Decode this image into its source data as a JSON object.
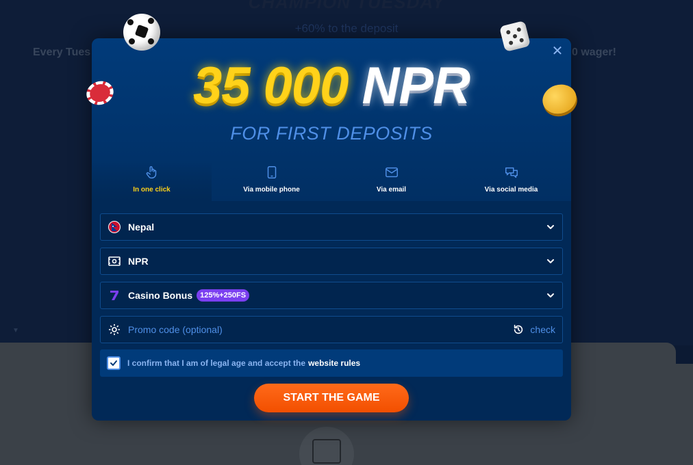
{
  "background": {
    "heading": "CHAMPION TUESDAY",
    "subheading": "+60% to the deposit",
    "left_text": "Every Tues",
    "right_text": "0 wager!"
  },
  "modal": {
    "close_label": "✕",
    "amount_number": "35 000",
    "amount_currency": "NPR",
    "subtitle": "FOR FIRST DEPOSITS",
    "tabs": [
      {
        "label": "In one click",
        "icon": "pointer-hand-icon",
        "active": true
      },
      {
        "label": "Via mobile phone",
        "icon": "mobile-phone-icon",
        "active": false
      },
      {
        "label": "Via email",
        "icon": "envelope-icon",
        "active": false
      },
      {
        "label": "Via social media",
        "icon": "chat-bubbles-icon",
        "active": false
      }
    ],
    "country": {
      "value": "Nepal",
      "icon": "nepal-flag-icon"
    },
    "currency": {
      "value": "NPR",
      "icon": "banknote-icon"
    },
    "bonus": {
      "value": "Casino Bonus",
      "badge": "125%+250FS",
      "icon": "casino-seven-icon"
    },
    "promo": {
      "placeholder": "Promo code (optional)",
      "value": "",
      "check_label": "check"
    },
    "confirm": {
      "text": "I confirm that I am of legal age and accept the",
      "link": "website rules",
      "checked": true
    },
    "start_button": "START THE GAME"
  },
  "colors": {
    "accent_yellow": "#ffd21a",
    "accent_blue": "#4f8fe6",
    "modal_bg": "#012957",
    "button_orange": "#f24f00",
    "badge_purple": "#7b3ff0"
  }
}
